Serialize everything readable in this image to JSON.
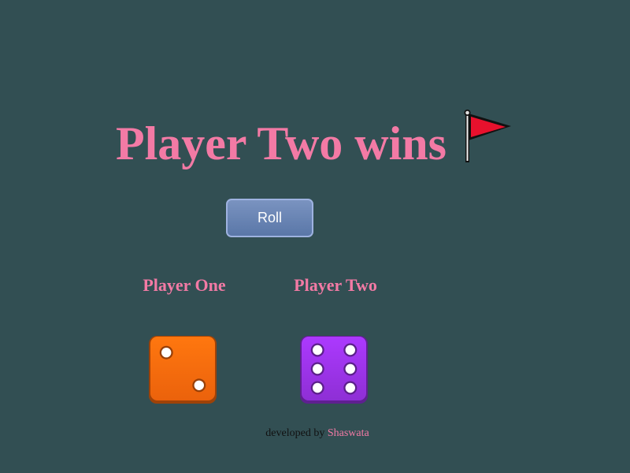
{
  "title": {
    "text": "Player Two wins",
    "icon": "red-flag-icon"
  },
  "controls": {
    "roll_label": "Roll"
  },
  "players": [
    {
      "label": "Player One",
      "die_value": 2,
      "die_color": "#ff6a0d"
    },
    {
      "label": "Player Two",
      "die_value": 6,
      "die_color": "#9a33e8"
    }
  ],
  "footer": {
    "prefix": "developed by",
    "author": "Shaswata"
  },
  "colors": {
    "background": "#324f53",
    "accent": "#f37aa5",
    "button": "#6a84b4"
  }
}
